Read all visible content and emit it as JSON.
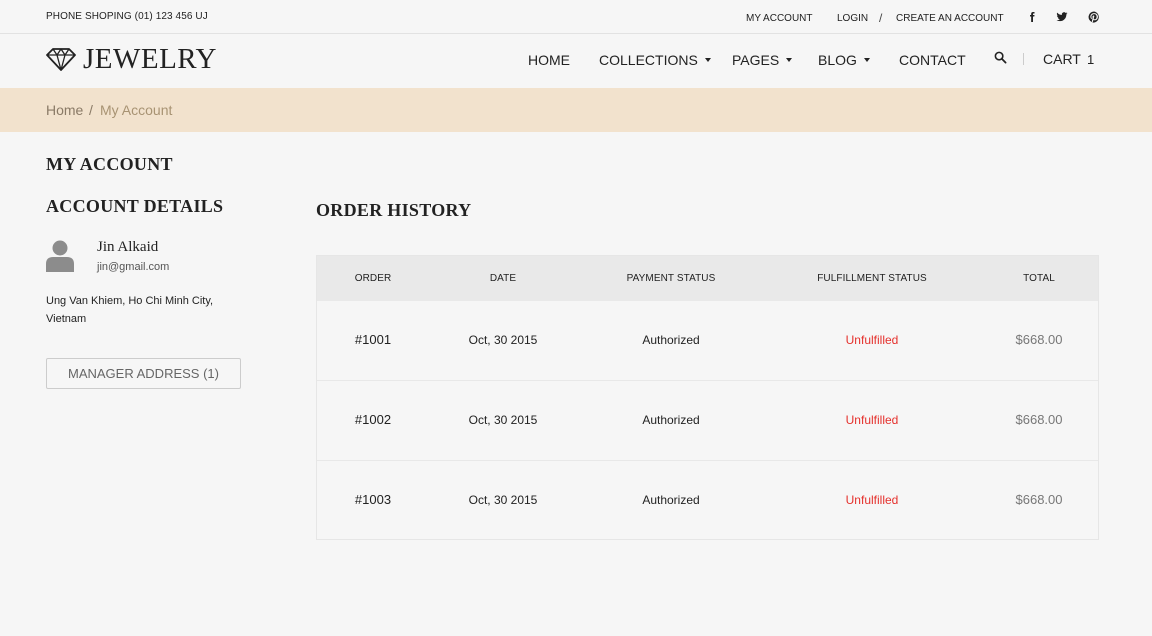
{
  "topbar": {
    "phone": "PHONE SHOPING (01) 123 456 UJ",
    "my_account": "MY ACCOUNT",
    "login": "LOGIN",
    "separator": "/",
    "create_account": "CREATE AN ACCOUNT",
    "social_icons": [
      "facebook-icon",
      "twitter-icon",
      "pinterest-icon"
    ]
  },
  "header": {
    "logo_text": "JEWELRY",
    "nav": {
      "home": "HOME",
      "collections": "COLLECTIONS",
      "pages": "PAGES",
      "blog": "BLOG",
      "contact": "CONTACT"
    },
    "cart_label": "CART",
    "cart_count": "1"
  },
  "breadcrumb": {
    "home": "Home",
    "separator": "/",
    "current": "My Account"
  },
  "sidebar": {
    "title": "MY ACCOUNT",
    "details_title": "ACCOUNT DETAILS",
    "user_name": "Jin Alkaid",
    "user_email": "jin@gmail.com",
    "address": "Ung Van Khiem, Ho Chi Minh City, Vietnam",
    "manage_button": "MANAGER ADDRESS (1)"
  },
  "orders": {
    "title": "ORDER HISTORY",
    "columns": [
      "ORDER",
      "DATE",
      "PAYMENT STATUS",
      "FULFILLMENT STATUS",
      "TOTAL"
    ],
    "rows": [
      {
        "order": "#1001",
        "date": "Oct, 30 2015",
        "payment": "Authorized",
        "fulfillment": "Unfulfilled",
        "total": "$668.00"
      },
      {
        "order": "#1002",
        "date": "Oct, 30 2015",
        "payment": "Authorized",
        "fulfillment": "Unfulfilled",
        "total": "$668.00"
      },
      {
        "order": "#1003",
        "date": "Oct, 30 2015",
        "payment": "Authorized",
        "fulfillment": "Unfulfilled",
        "total": "$668.00"
      }
    ]
  },
  "colors": {
    "breadcrumb_bg": "#f2e2cd",
    "unfulfilled": "#e5302c",
    "page_bg": "#f6f6f6"
  }
}
